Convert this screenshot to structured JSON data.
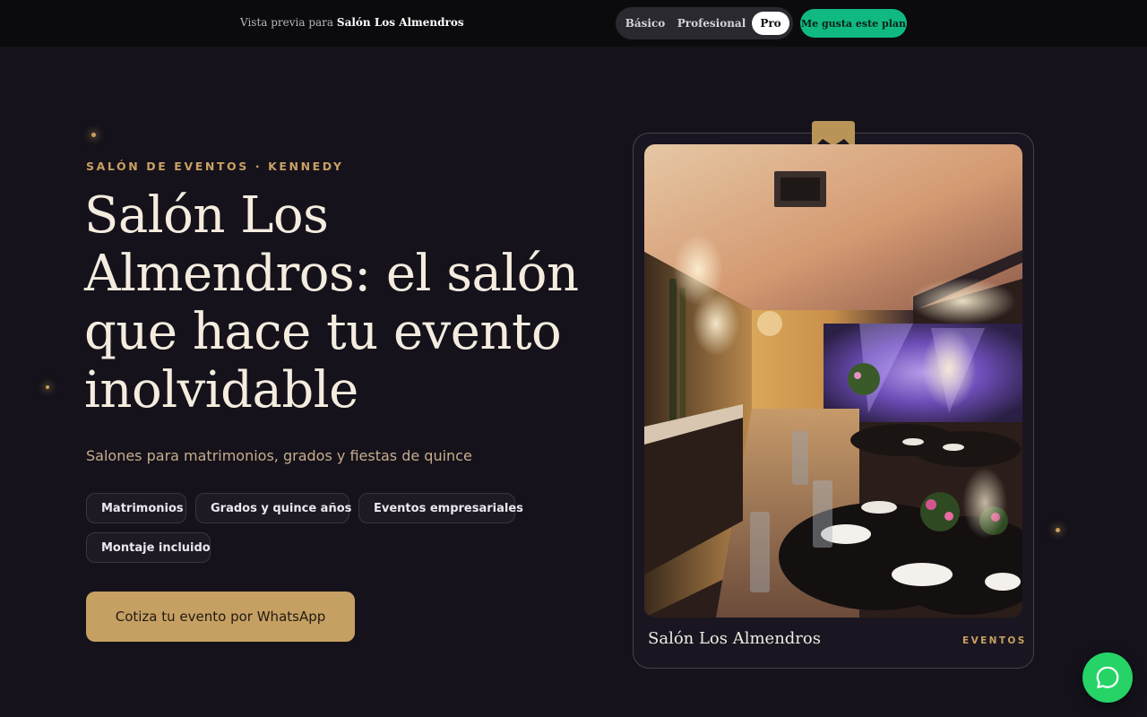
{
  "preview_bar": {
    "prefix": "Vista previa para",
    "business_name": "Salón Los Almendros",
    "plans": [
      "Básico",
      "Profesional",
      "Pro"
    ],
    "active_plan": "Pro",
    "like_button": "Me gusta este plan"
  },
  "hero": {
    "eyebrow": "SALÓN DE EVENTOS · KENNEDY",
    "title": "Salón Los Almendros: el salón que hace tu evento inolvidable",
    "subtitle": "Salones para matrimonios, grados y fiestas de quince",
    "chips": [
      "Matrimonios",
      "Grados y quince años",
      "Eventos empresariales",
      "Montaje incluido"
    ],
    "cta": "Cotiza tu evento por WhatsApp"
  },
  "card": {
    "name": "Salón Los Almendros",
    "tag": "EVENTOS",
    "image_icon": "event-hall-photo"
  },
  "floating": {
    "whatsapp_icon": "whatsapp-icon"
  },
  "colors": {
    "background": "#15121b",
    "accent_gold": "#c6a062",
    "whatsapp_green": "#25d366",
    "plan_green": "#10b981"
  }
}
